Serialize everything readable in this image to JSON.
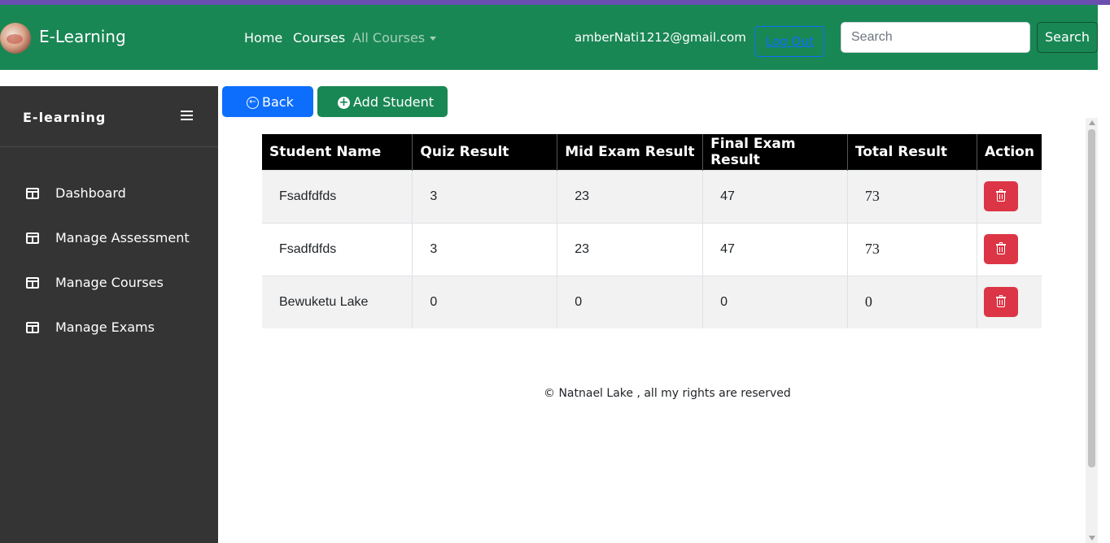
{
  "navbar": {
    "brand": "E-Learning",
    "links": [
      {
        "label": "Home"
      },
      {
        "label": "Courses"
      },
      {
        "label": "All Courses"
      }
    ],
    "user_email": "amberNati1212@gmail.com",
    "logout_label": "Log Out",
    "search": {
      "placeholder": "Search",
      "value": "",
      "button_label": "Search"
    }
  },
  "sidebar": {
    "title": "E-learning",
    "items": [
      {
        "label": "Dashboard",
        "icon": "table-layout-icon"
      },
      {
        "label": "Manage Assessment",
        "icon": "table-layout-icon"
      },
      {
        "label": "Manage Courses",
        "icon": "table-layout-icon"
      },
      {
        "label": "Manage Exams",
        "icon": "table-layout-icon"
      }
    ]
  },
  "toolbar": {
    "back_label": "Back",
    "add_student_label": "Add Student"
  },
  "results_table": {
    "headers": [
      "Student Name",
      "Quiz Result",
      "Mid Exam Result",
      "Final Exam Result",
      "Total Result",
      "Action"
    ],
    "rows": [
      {
        "name": "Fsadfdfds",
        "quiz": "3",
        "mid": "23",
        "final": "47",
        "total": "73"
      },
      {
        "name": "Fsadfdfds",
        "quiz": "3",
        "mid": "23",
        "final": "47",
        "total": "73"
      },
      {
        "name": "Bewuketu Lake",
        "quiz": "0",
        "mid": "0",
        "final": "0",
        "total": "0"
      }
    ]
  },
  "footer": {
    "text": "© Natnael Lake , all my rights are reserved"
  },
  "colors": {
    "navbar": "#198754",
    "sidebar": "#343434",
    "primary": "#0d6efd",
    "danger": "#dc3545",
    "table_header": "#000000"
  }
}
